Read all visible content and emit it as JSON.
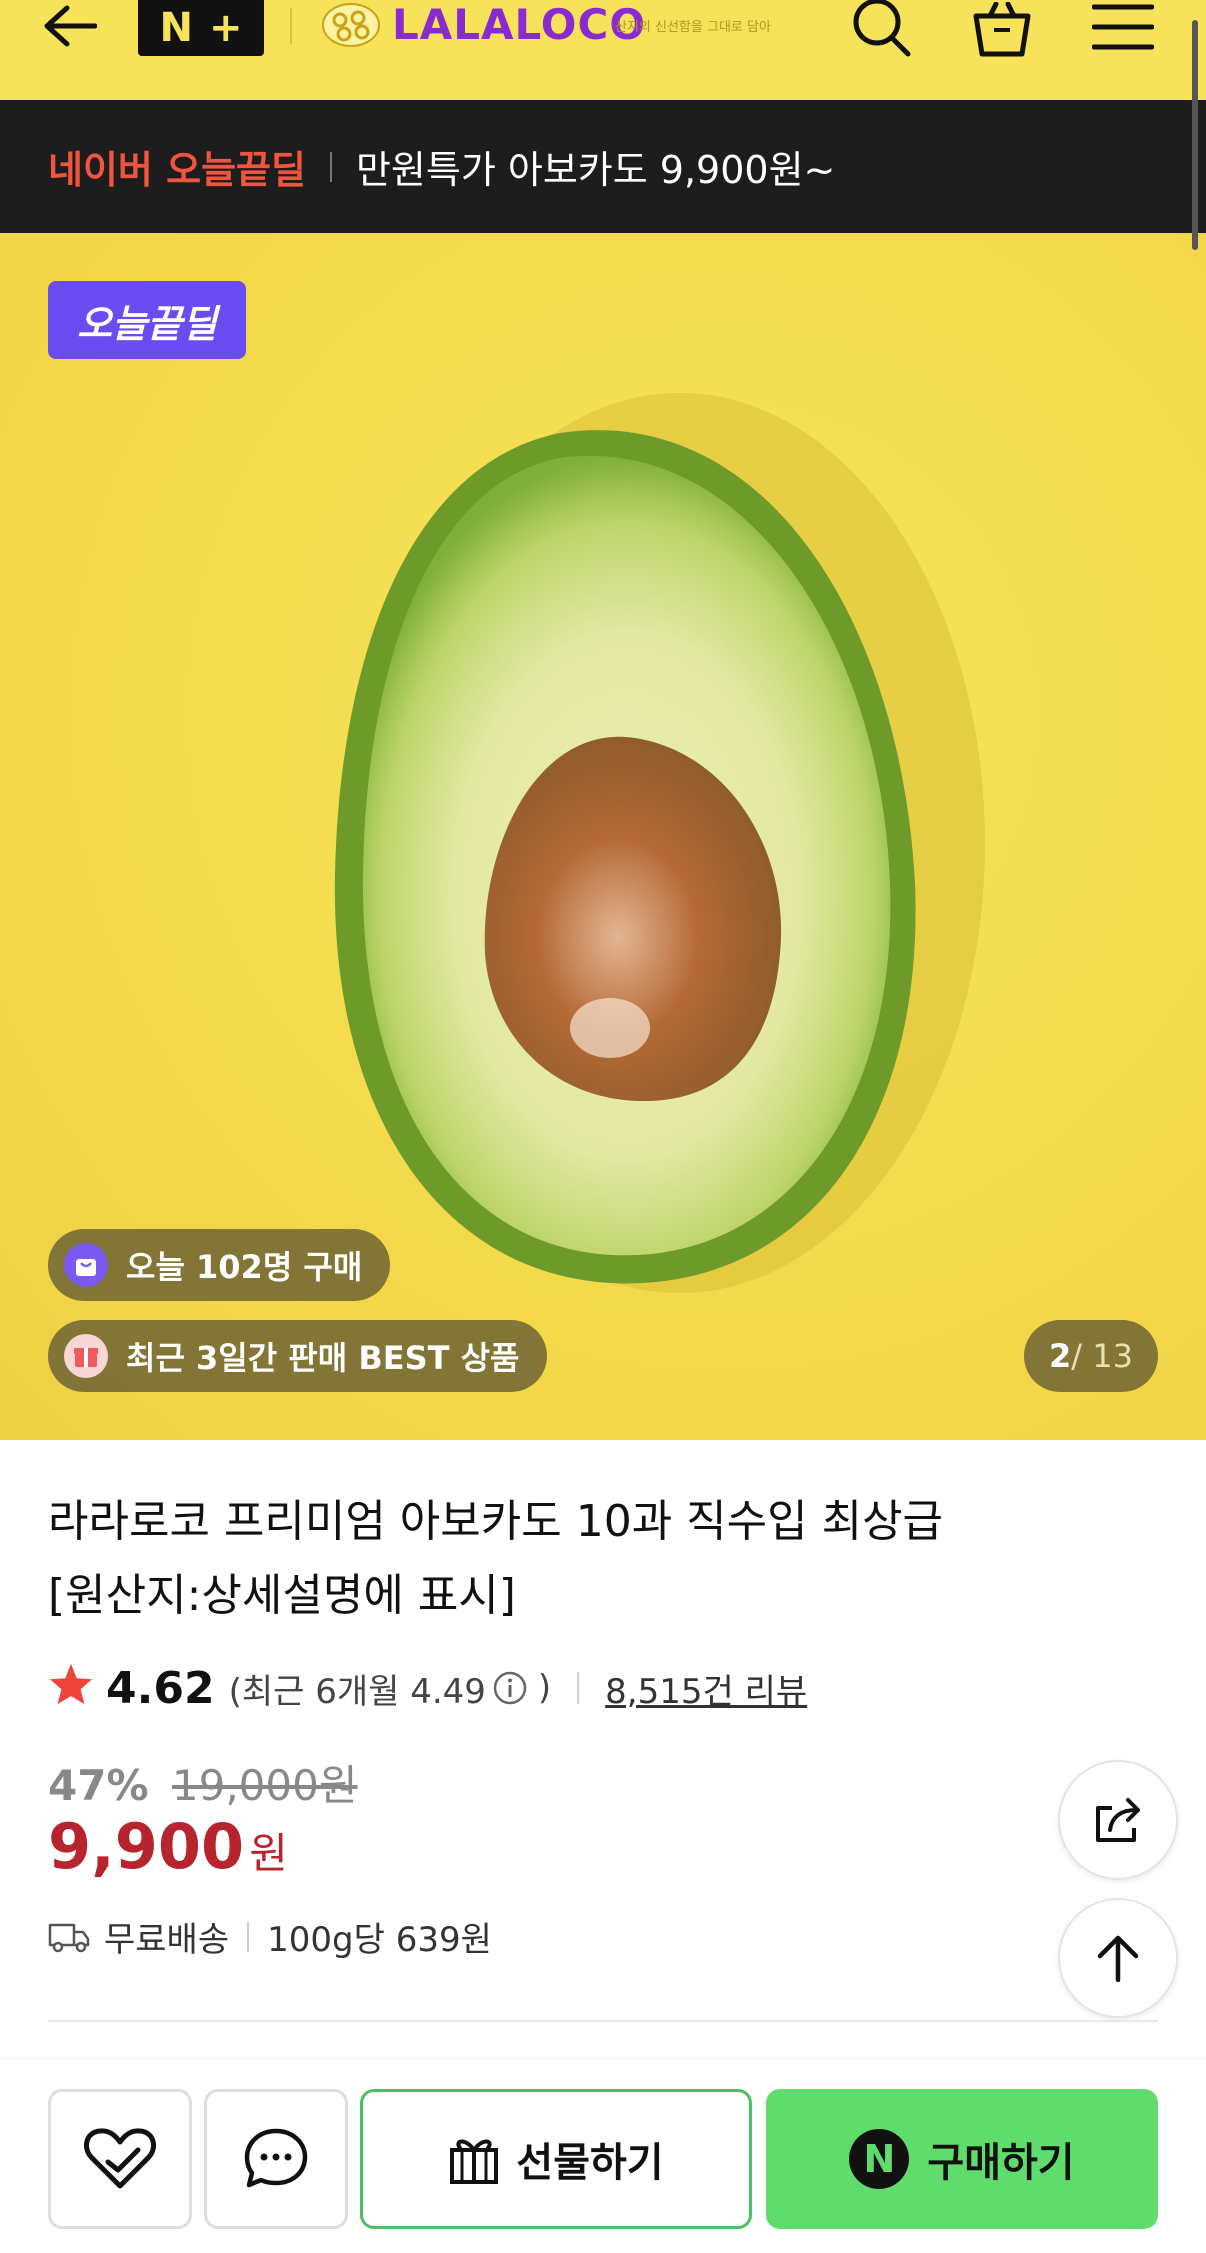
{
  "header": {
    "nplus_label": "N",
    "nplus_plus": "+",
    "brand_name": "LALALOCO",
    "brand_logo_text": "LALALOCO",
    "brand_tagline": "산지의 신선함을 그대로 담아"
  },
  "banner": {
    "highlight": "네이버 오늘끝딜",
    "text": "만원특가 아보카도 9,900원~"
  },
  "hero": {
    "deal_badge": "오늘끝딜",
    "today_purchase": "오늘 102명 구매",
    "best_badge": "최근 3일간 판매 BEST 상품",
    "counter_current": "2",
    "counter_total": " / 13"
  },
  "product": {
    "title_line1": "라라로코 프리미엄 아보카도 10과 직수입 최상급",
    "title_line2": "[원산지:상세설명에 표시]",
    "rating": "4.62",
    "recent_rating": "(최근 6개월 4.49",
    "recent_close": ")",
    "review_count": "8,515건 리뷰",
    "discount_pct": "47%",
    "original_price": "19,000원",
    "price": "9,900",
    "price_unit": "원",
    "shipping": "무료배송",
    "unit_price": "100g당 639원"
  },
  "bottom_bar": {
    "gift_label": "선물하기",
    "buy_label": "구매하기",
    "buy_n": "N"
  },
  "colors": {
    "header_bg": "#f7e35a",
    "banner_bg": "#1d1d1d",
    "deal_red": "#f2553f",
    "deal_badge": "#6b4cf0",
    "price_red": "#b8242d",
    "buy_green": "#5fdc6b"
  }
}
